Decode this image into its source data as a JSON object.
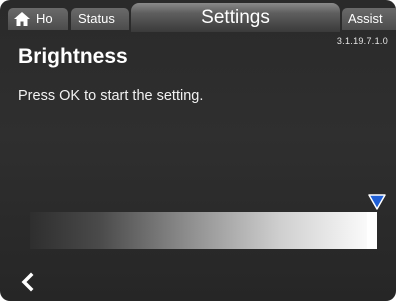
{
  "tabs": {
    "home_label": "Ho",
    "status_label": "Status",
    "settings_label": "Settings",
    "assist_label": "Assist"
  },
  "version": "3.1.19.7.1.0",
  "page": {
    "title": "Brightness",
    "instruction": "Press OK to start the setting."
  },
  "slider": {
    "level": 1.0
  },
  "icons": {
    "home": "home-icon",
    "marker": "triangle-down-marker-icon",
    "back": "chevron-left-icon"
  },
  "colors": {
    "marker": "#1f5fd6",
    "background": "#2c2c2c",
    "text": "#ffffff"
  }
}
